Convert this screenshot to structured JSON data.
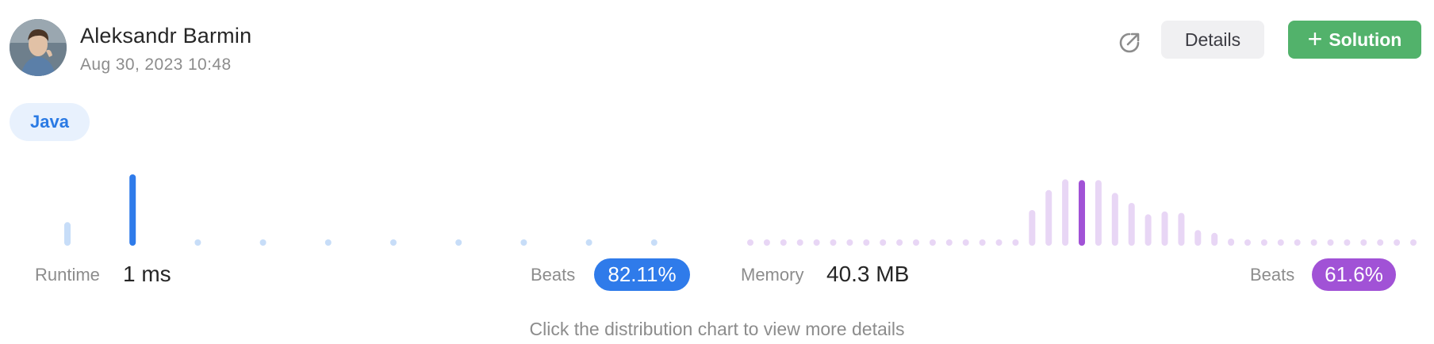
{
  "user": {
    "name": "Aleksandr Barmin",
    "date": "Aug 30, 2023 10:48"
  },
  "actions": {
    "details_label": "Details",
    "solution_label": "Solution",
    "solution_icon": "plus-icon",
    "share_icon": "share-external-icon"
  },
  "language": "Java",
  "runtime": {
    "label": "Runtime",
    "value": "1 ms",
    "beats_label": "Beats",
    "beats_value": "82.11%",
    "color": "#2f7bea",
    "light_color": "#c7ddf8",
    "selected_index": 1,
    "bars": [
      0.33,
      1.0,
      0.03,
      0.03,
      0.03,
      0.03,
      0.03,
      0.03,
      0.09,
      0.03
    ]
  },
  "memory": {
    "label": "Memory",
    "value": "40.3 MB",
    "beats_label": "Beats",
    "beats_value": "61.6%",
    "color": "#a152d6",
    "light_color": "#e8d6f5",
    "selected_index": 20,
    "bars": [
      0.03,
      0.03,
      0.03,
      0.03,
      0.03,
      0.03,
      0.03,
      0.03,
      0.03,
      0.03,
      0.03,
      0.03,
      0.03,
      0.03,
      0.03,
      0.03,
      0.07,
      0.5,
      0.78,
      0.93,
      0.92,
      0.92,
      0.74,
      0.6,
      0.44,
      0.48,
      0.46,
      0.22,
      0.18,
      0.1,
      0.06,
      0.06,
      0.06,
      0.06,
      0.06,
      0.06,
      0.06,
      0.06,
      0.06,
      0.06,
      0.06
    ]
  },
  "footer_hint": "Click the distribution chart to view more details"
}
